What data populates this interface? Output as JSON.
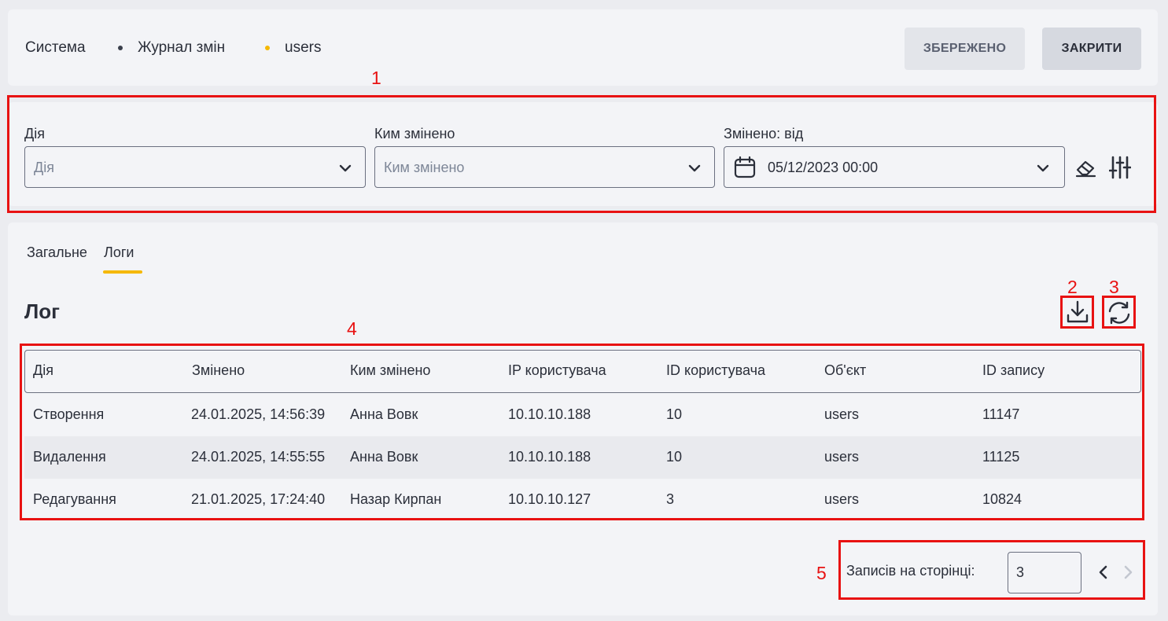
{
  "breadcrumb": {
    "items": [
      "Система",
      "Журнал змін",
      "users"
    ],
    "separator_colors": [
      "#3a3f4b",
      "#f5b800"
    ]
  },
  "header": {
    "saved_label": "ЗБЕРЕЖЕНО",
    "close_label": "ЗАКРИТИ"
  },
  "annotations": [
    "1",
    "2",
    "3",
    "4",
    "5"
  ],
  "filters": {
    "action": {
      "label": "Дія",
      "placeholder": "Дія"
    },
    "changed_by": {
      "label": "Ким змінено",
      "placeholder": "Ким змінено"
    },
    "changed_from": {
      "label": "Змінено: від",
      "value": "05/12/2023 00:00"
    }
  },
  "tabs": [
    {
      "label": "Загальне",
      "active": false
    },
    {
      "label": "Логи",
      "active": true
    }
  ],
  "log": {
    "title": "Лог",
    "columns": [
      "Дія",
      "Змінено",
      "Ким змінено",
      "IP користувача",
      "ID користувача",
      "Об'єкт",
      "ID запису"
    ],
    "rows": [
      [
        "Створення",
        "24.01.2025, 14:56:39",
        "Анна Вовк",
        "10.10.10.188",
        "10",
        "users",
        "11147"
      ],
      [
        "Видалення",
        "24.01.2025, 14:55:55",
        "Анна Вовк",
        "10.10.10.188",
        "10",
        "users",
        "11125"
      ],
      [
        "Редагування",
        "21.01.2025, 17:24:40",
        "Назар Кирпан",
        "10.10.10.127",
        "3",
        "users",
        "10824"
      ]
    ]
  },
  "pagination": {
    "per_page_label": "Записів на сторінці:",
    "per_page_value": "3"
  },
  "colors": {
    "accent": "#f5b800",
    "annotation": "#e81212",
    "alt_row": "#e9eaee"
  },
  "icons": {
    "chevron": "chevron-down-icon",
    "calendar": "calendar-icon",
    "eraser": "eraser-icon",
    "filter": "sliders-icon",
    "download": "download-icon",
    "refresh": "refresh-icon",
    "prev": "chevron-left-icon",
    "next": "chevron-right-icon"
  }
}
